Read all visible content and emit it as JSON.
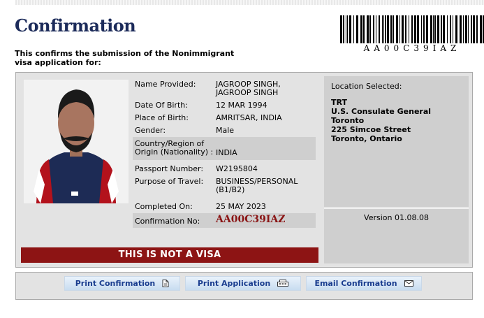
{
  "header": {
    "title": "Confirmation",
    "intro": "This confirms the submission of the Nonimmigrant visa application for:",
    "barcode_text": "AA00C39IAZ"
  },
  "applicant": {
    "name_label": "Name Provided:",
    "name_value": "JAGROOP SINGH, JAGROOP SINGH",
    "dob_label": "Date Of Birth:",
    "dob_value": "12 MAR 1994",
    "pob_label": "Place of Birth:",
    "pob_value": "AMRITSAR, INDIA",
    "gender_label": "Gender:",
    "gender_value": "Male",
    "country_label": "Country/Region of Origin (Nationality) :",
    "country_value": "INDIA",
    "passport_label": "Passport Number:",
    "passport_value": "W2195804",
    "purpose_label": "Purpose of Travel:",
    "purpose_value": "BUSINESS/PERSONAL (B1/B2)",
    "completed_label": "Completed On:",
    "completed_value": "25 MAY 2023",
    "confno_label": "Confirmation No:",
    "confno_value": "AA00C39IAZ"
  },
  "banner": "THIS IS NOT A VISA",
  "location": {
    "title": "Location Selected:",
    "code": "TRT",
    "line1": "U.S. Consulate General Toronto",
    "line2": "225 Simcoe Street",
    "line3": "Toronto, Ontario"
  },
  "version": "Version 01.08.08",
  "buttons": {
    "print_confirmation": "Print Confirmation",
    "print_application": "Print Application",
    "email_confirmation": "Email Confirmation"
  },
  "icons": [
    "document-icon",
    "printer-icon",
    "envelope-icon"
  ]
}
